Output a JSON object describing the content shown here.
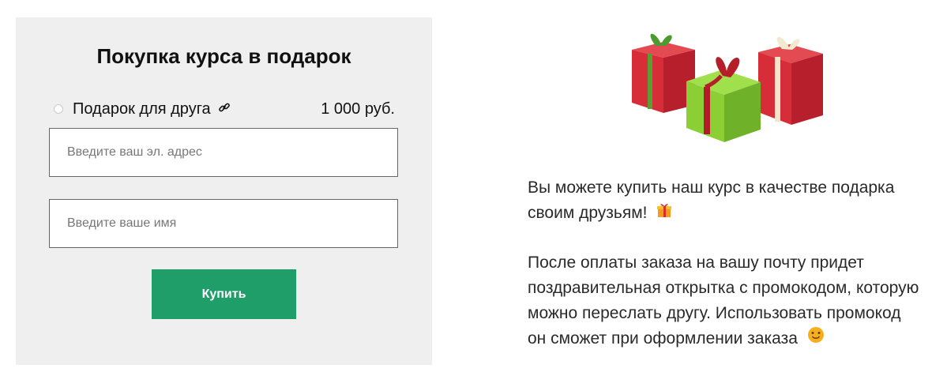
{
  "gift_form": {
    "title": "Покупка курса в подарок",
    "option": {
      "label": "Подарок для друга",
      "price": "1 000 руб.",
      "icon": "link-icon"
    },
    "email_placeholder": "Введите ваш эл. адрес",
    "name_placeholder": "Введите ваше имя",
    "buy_label": "Купить"
  },
  "info": {
    "image": "gift-boxes",
    "paragraph1": "Вы можете купить наш курс в качестве подарка своим друзьям!",
    "paragraph1_icon": "gift-emoji",
    "paragraph2": "После оплаты заказа на вашу почту придет поздравительная открытка с промокодом, которую можно переслать другу. Использовать промокод он сможет при оформлении заказа",
    "paragraph2_icon": "smile-emoji"
  },
  "colors": {
    "panel_bg": "#efefef",
    "button_bg": "#1f9e6a",
    "button_text": "#ffffff"
  }
}
